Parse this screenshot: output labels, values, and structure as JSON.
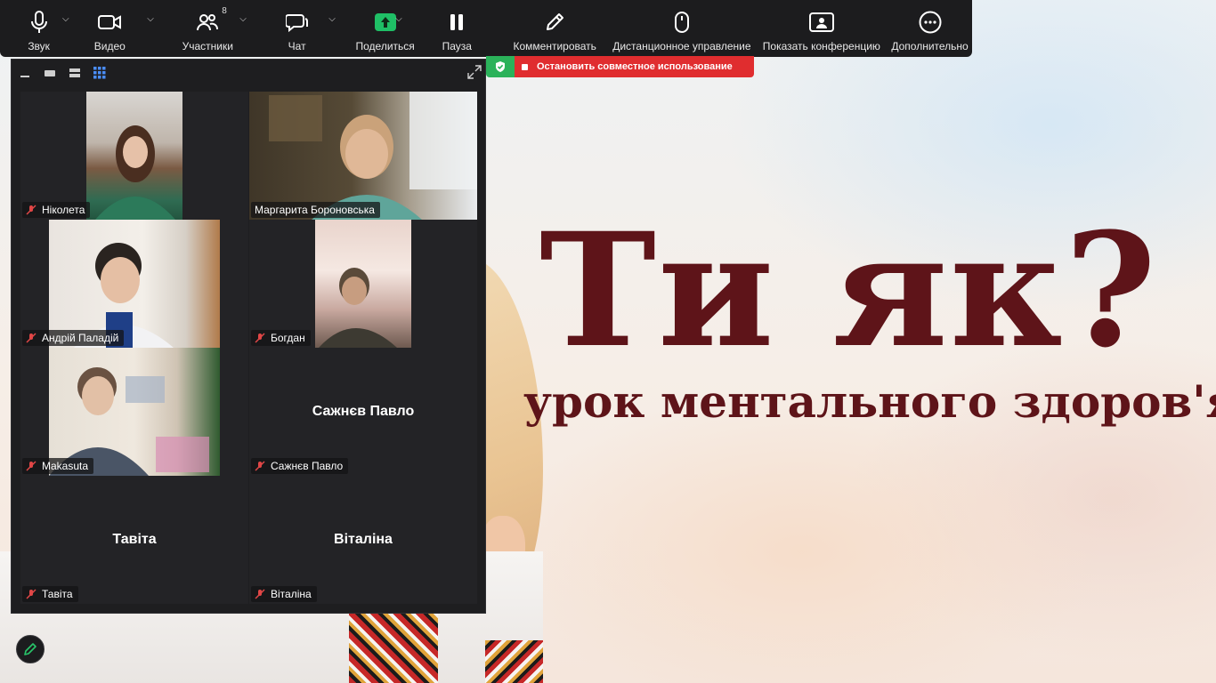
{
  "toolbar": {
    "items": [
      {
        "id": "audio",
        "label": "Звук",
        "icon": "microphone-icon"
      },
      {
        "id": "video",
        "label": "Видео",
        "icon": "video-camera-icon"
      },
      {
        "id": "participants",
        "label": "Участники",
        "icon": "participants-icon",
        "badge": "8"
      },
      {
        "id": "chat",
        "label": "Чат",
        "icon": "chat-icon"
      },
      {
        "id": "share",
        "label": "Поделиться",
        "icon": "share-screen-icon"
      },
      {
        "id": "pause",
        "label": "Пауза",
        "icon": "pause-icon"
      },
      {
        "id": "annotate",
        "label": "Комментировать",
        "icon": "pencil-icon"
      },
      {
        "id": "remote",
        "label": "Дистанционное управление",
        "icon": "mouse-icon"
      },
      {
        "id": "show",
        "label": "Показать конференцию",
        "icon": "conference-icon"
      },
      {
        "id": "more",
        "label": "Дополнительно",
        "icon": "more-icon"
      }
    ]
  },
  "share_bar": {
    "stop_label": "Остановить совместное использование",
    "shield_icon": "shield-check-icon"
  },
  "gallery": {
    "tiles": [
      {
        "name": "Ніколета",
        "muted": true,
        "video": true,
        "active": false
      },
      {
        "name": "Маргарита Бороновська",
        "muted": false,
        "video": true,
        "active": true
      },
      {
        "name": "Андрій Паладій",
        "muted": true,
        "video": true,
        "active": false
      },
      {
        "name": "Богдан",
        "muted": true,
        "video": true,
        "active": false
      },
      {
        "name": "Makasuta",
        "muted": true,
        "video": true,
        "active": false
      },
      {
        "name": "Сажнєв Павло",
        "center": "Сажнєв Павло",
        "muted": true,
        "video": false,
        "active": false
      },
      {
        "name": "Тавіта",
        "center": "Тавіта",
        "muted": true,
        "video": false,
        "active": false
      },
      {
        "name": "Віталіна",
        "center": "Віталіна",
        "muted": true,
        "video": false,
        "active": false
      }
    ]
  },
  "slide": {
    "title": "Ти як?",
    "subtitle": "урок ментального здоров'я"
  },
  "colors": {
    "accent_green": "#28c56a",
    "stop_red": "#e02d2f",
    "slide_text": "#5e1419"
  }
}
